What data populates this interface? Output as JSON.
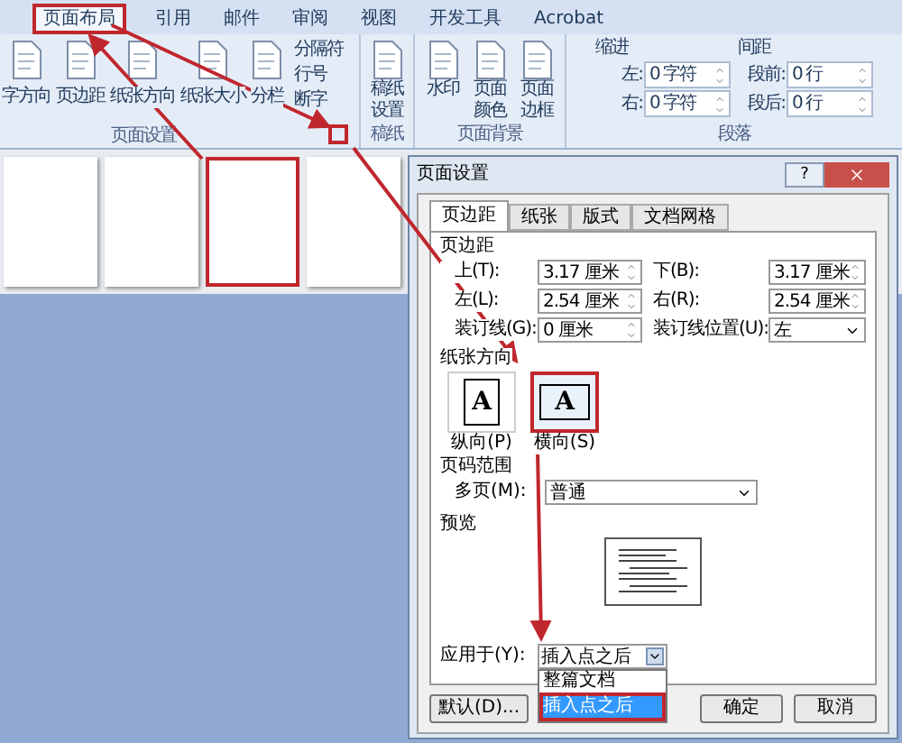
{
  "ribbon": {
    "tabs": [
      {
        "label": "页面布局",
        "selected": true
      },
      {
        "label": "引用",
        "selected": false
      },
      {
        "label": "邮件",
        "selected": false
      },
      {
        "label": "审阅",
        "selected": false
      },
      {
        "label": "视图",
        "selected": false
      },
      {
        "label": "开发工具",
        "selected": false
      },
      {
        "label": "Acrobat",
        "selected": false
      }
    ],
    "page_setup": {
      "label": "页面设置",
      "buttons": [
        "字方向",
        "页边距",
        "纸张方向",
        "纸张大小",
        "分栏"
      ],
      "small_buttons": [
        "分隔符",
        "行号",
        "断字"
      ]
    },
    "manuscript": {
      "label": "稿纸",
      "buttons": [
        "稿纸设置"
      ]
    },
    "background": {
      "label": "页面背景",
      "buttons": [
        "水印",
        "页面颜色",
        "页面边框"
      ]
    },
    "paragraph": {
      "label": "段落",
      "indent_heading": "缩进",
      "indent": [
        {
          "label": "左:",
          "value": "0 字符"
        },
        {
          "label": "右:",
          "value": "0 字符"
        }
      ],
      "spacing_heading": "间距",
      "spacing": [
        {
          "label": "段前:",
          "value": "0 行"
        },
        {
          "label": "段后:",
          "value": "0 行"
        }
      ]
    }
  },
  "pages": [
    {
      "highlighted": false
    },
    {
      "highlighted": false
    },
    {
      "highlighted": true
    },
    {
      "highlighted": false
    }
  ],
  "dialog": {
    "title": "页面设置",
    "help_glyph": "?",
    "tabs": [
      {
        "label": "页边距",
        "selected": true
      },
      {
        "label": "纸张",
        "selected": false
      },
      {
        "label": "版式",
        "selected": false
      },
      {
        "label": "文档网格",
        "selected": false
      }
    ],
    "margins_heading": "页边距",
    "margin_fields": [
      {
        "label": "上(T):",
        "value": "3.17 厘米",
        "kind": "spin"
      },
      {
        "label": "下(B):",
        "value": "3.17 厘米",
        "kind": "spin"
      },
      {
        "label": "左(L):",
        "value": "2.54 厘米",
        "kind": "spin"
      },
      {
        "label": "右(R):",
        "value": "2.54 厘米",
        "kind": "spin"
      },
      {
        "label": "装订线(G):",
        "value": "0 厘米",
        "kind": "spin"
      },
      {
        "label": "装订线位置(U):",
        "value": "左",
        "kind": "select"
      }
    ],
    "orientation_heading": "纸张方向",
    "orientations": [
      {
        "label": "纵向(P)",
        "glyph": "A",
        "kind": "portrait",
        "selected": false
      },
      {
        "label": "横向(S)",
        "glyph": "A",
        "kind": "landscape",
        "selected": true
      }
    ],
    "pages_heading": "页码范围",
    "multi_pages": {
      "label": "多页(M):",
      "value": "普通"
    },
    "preview_heading": "预览",
    "apply_to": {
      "label": "应用于(Y):",
      "value": "插入点之后",
      "options": [
        {
          "label": "整篇文档",
          "selected": false
        },
        {
          "label": "插入点之后",
          "selected": true
        }
      ]
    },
    "buttons": [
      "默认(D)...",
      "确定",
      "取消"
    ]
  }
}
